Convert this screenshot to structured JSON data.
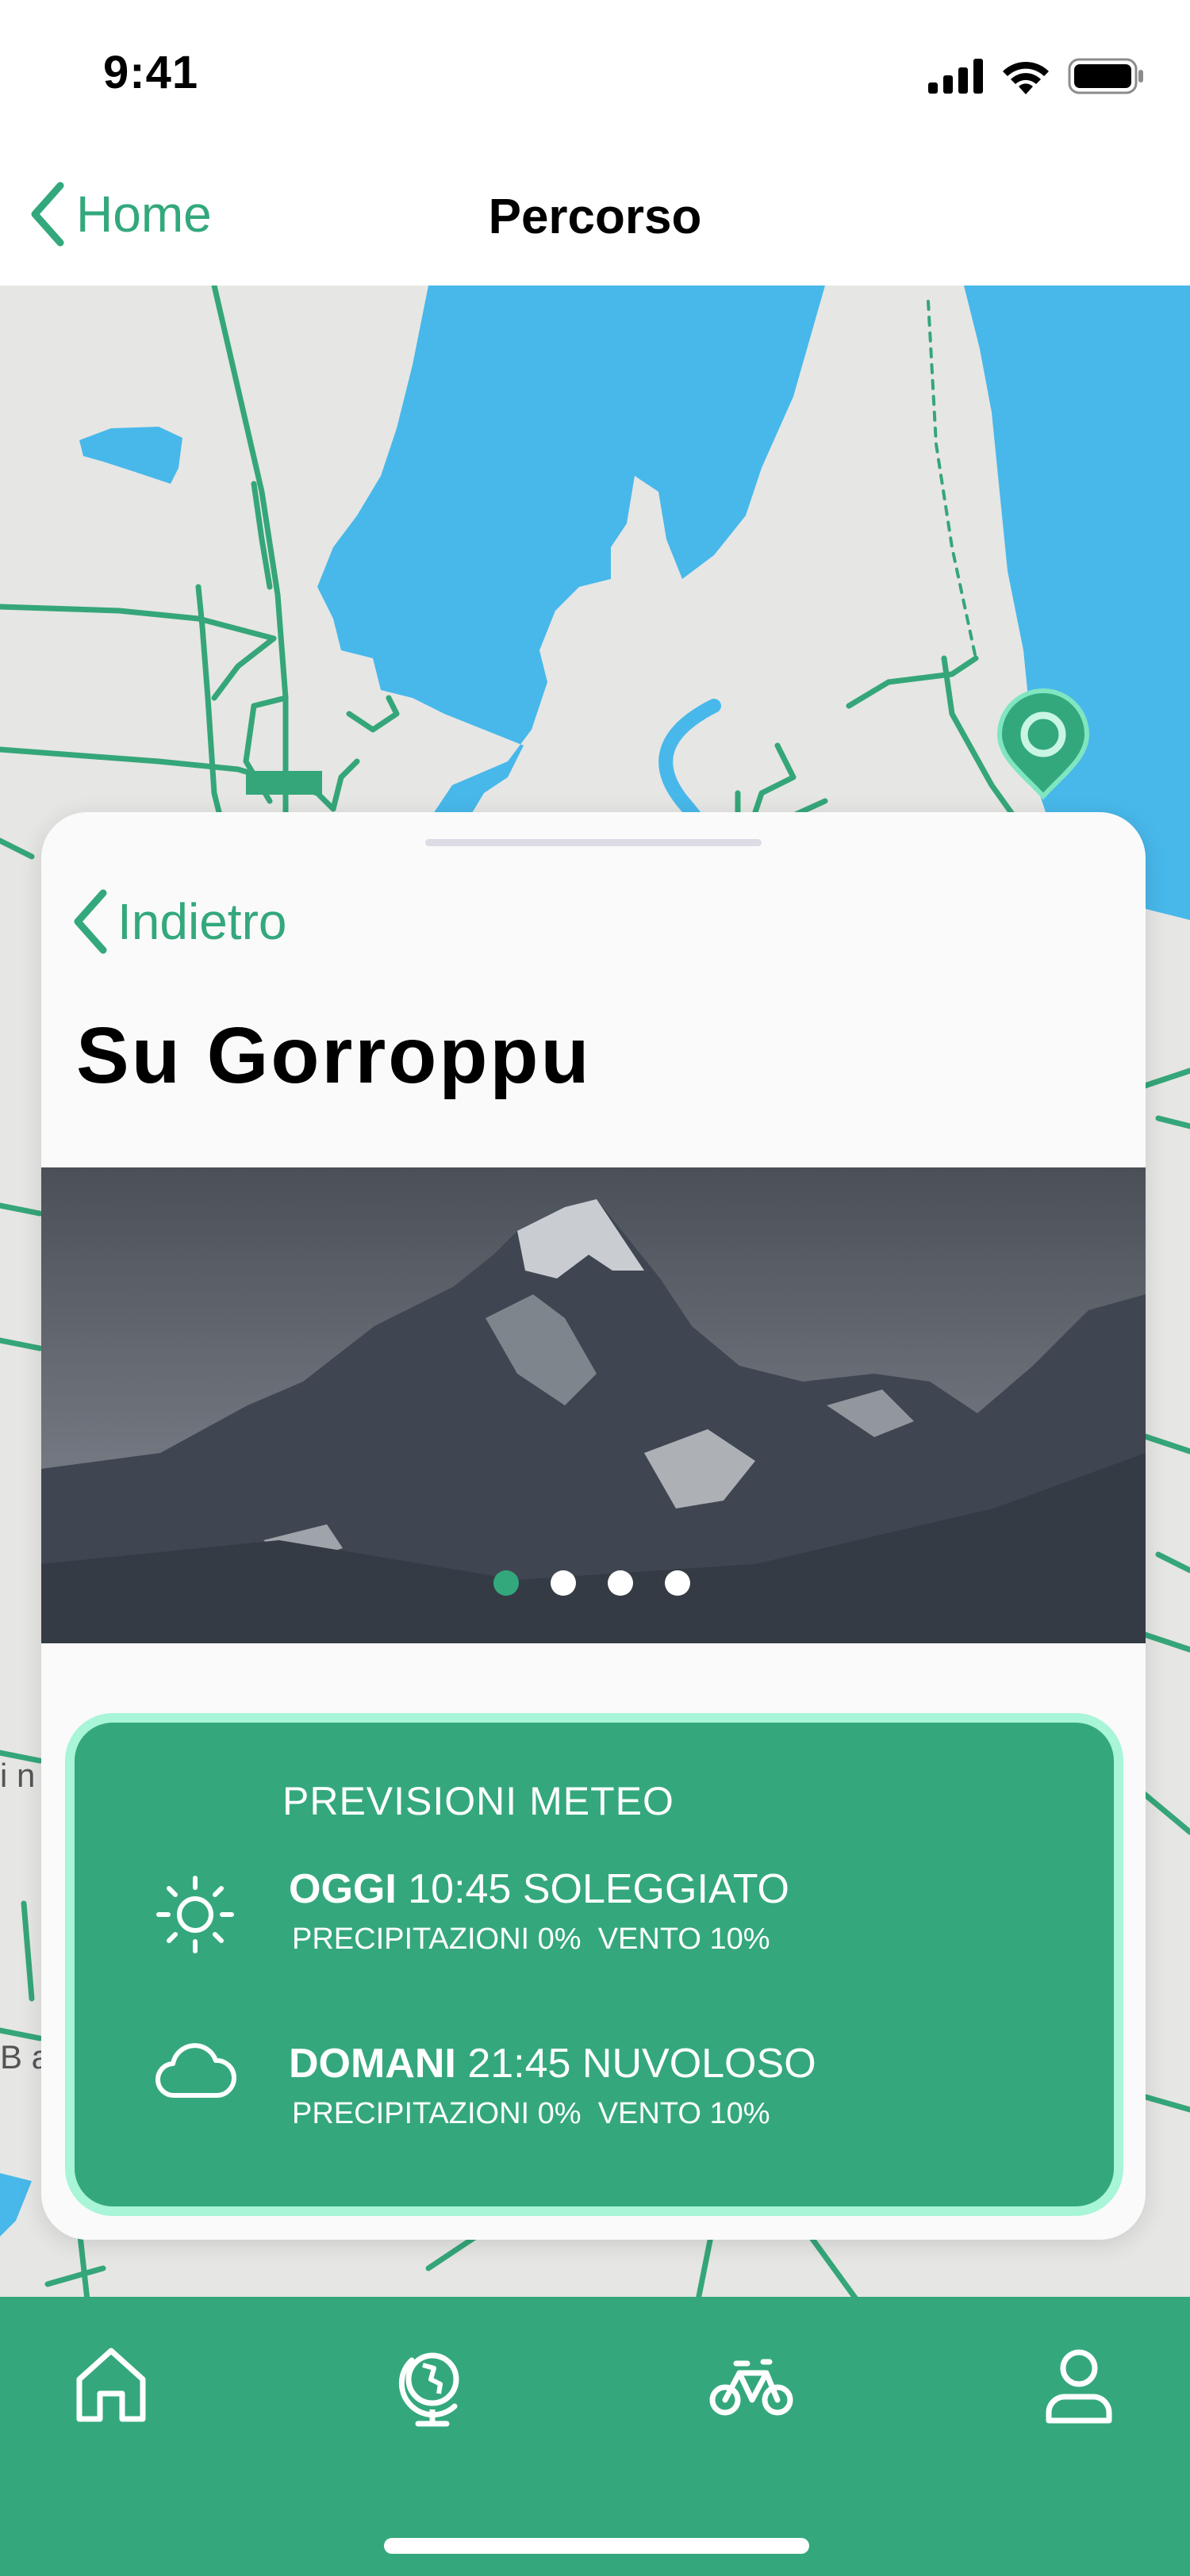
{
  "status_bar": {
    "time": "9:41"
  },
  "nav": {
    "back_label": "Home",
    "title": "Percorso"
  },
  "map": {
    "edge_labels": [
      "i n",
      "B a"
    ]
  },
  "card": {
    "back_label": "Indietro",
    "title": "Su Gorroppu",
    "gallery": {
      "total_images": 4,
      "active_index": 0
    },
    "weather": {
      "title": "PREVISIONI METEO",
      "today": {
        "day": "OGGI",
        "time_condition": "10:45 SOLEGGIATO",
        "details": "PRECIPITAZIONI 0%  VENTO 10%",
        "icon": "sun-icon"
      },
      "tomorrow": {
        "day": "DOMANI",
        "time_condition": "21:45 NUVOLOSO",
        "details": "PRECIPITAZIONI 0%  VENTO 10%",
        "icon": "cloud-icon"
      }
    }
  },
  "tab_bar": {
    "items": [
      {
        "name": "home",
        "icon": "home-icon"
      },
      {
        "name": "globe",
        "icon": "globe-icon"
      },
      {
        "name": "bike",
        "icon": "bike-icon"
      },
      {
        "name": "profile",
        "icon": "profile-icon"
      }
    ]
  },
  "colors": {
    "accent": "#33a87c",
    "water": "#48b8ea",
    "map_background": "#e6e6e4",
    "weather_border": "#a8f5d8"
  }
}
